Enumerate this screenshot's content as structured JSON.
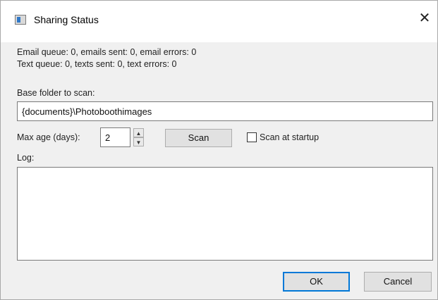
{
  "window": {
    "title": "Sharing Status",
    "close_glyph": "✕"
  },
  "status": {
    "email_line": "Email queue: 0, emails sent: 0, email errors: 0",
    "text_line": "Text queue: 0, texts sent: 0, text errors: 0"
  },
  "base_folder": {
    "label": "Base folder to scan:",
    "value": "{documents}\\Photoboothimages"
  },
  "max_age": {
    "label": "Max age (days):",
    "value": "2",
    "up_glyph": "▲",
    "down_glyph": "▼"
  },
  "scan_button": {
    "label": "Scan"
  },
  "scan_at_startup": {
    "label": "Scan at startup",
    "checked": false
  },
  "log": {
    "label": "Log:",
    "content": ""
  },
  "buttons": {
    "ok": "OK",
    "cancel": "Cancel"
  },
  "icons": {
    "app": "window-app-icon",
    "close": "close-icon",
    "spin_up": "spin-up-icon",
    "spin_down": "spin-down-icon"
  },
  "colors": {
    "window_bg": "#f0f0f0",
    "title_bg": "#ffffff",
    "default_button_border": "#0078d7"
  }
}
